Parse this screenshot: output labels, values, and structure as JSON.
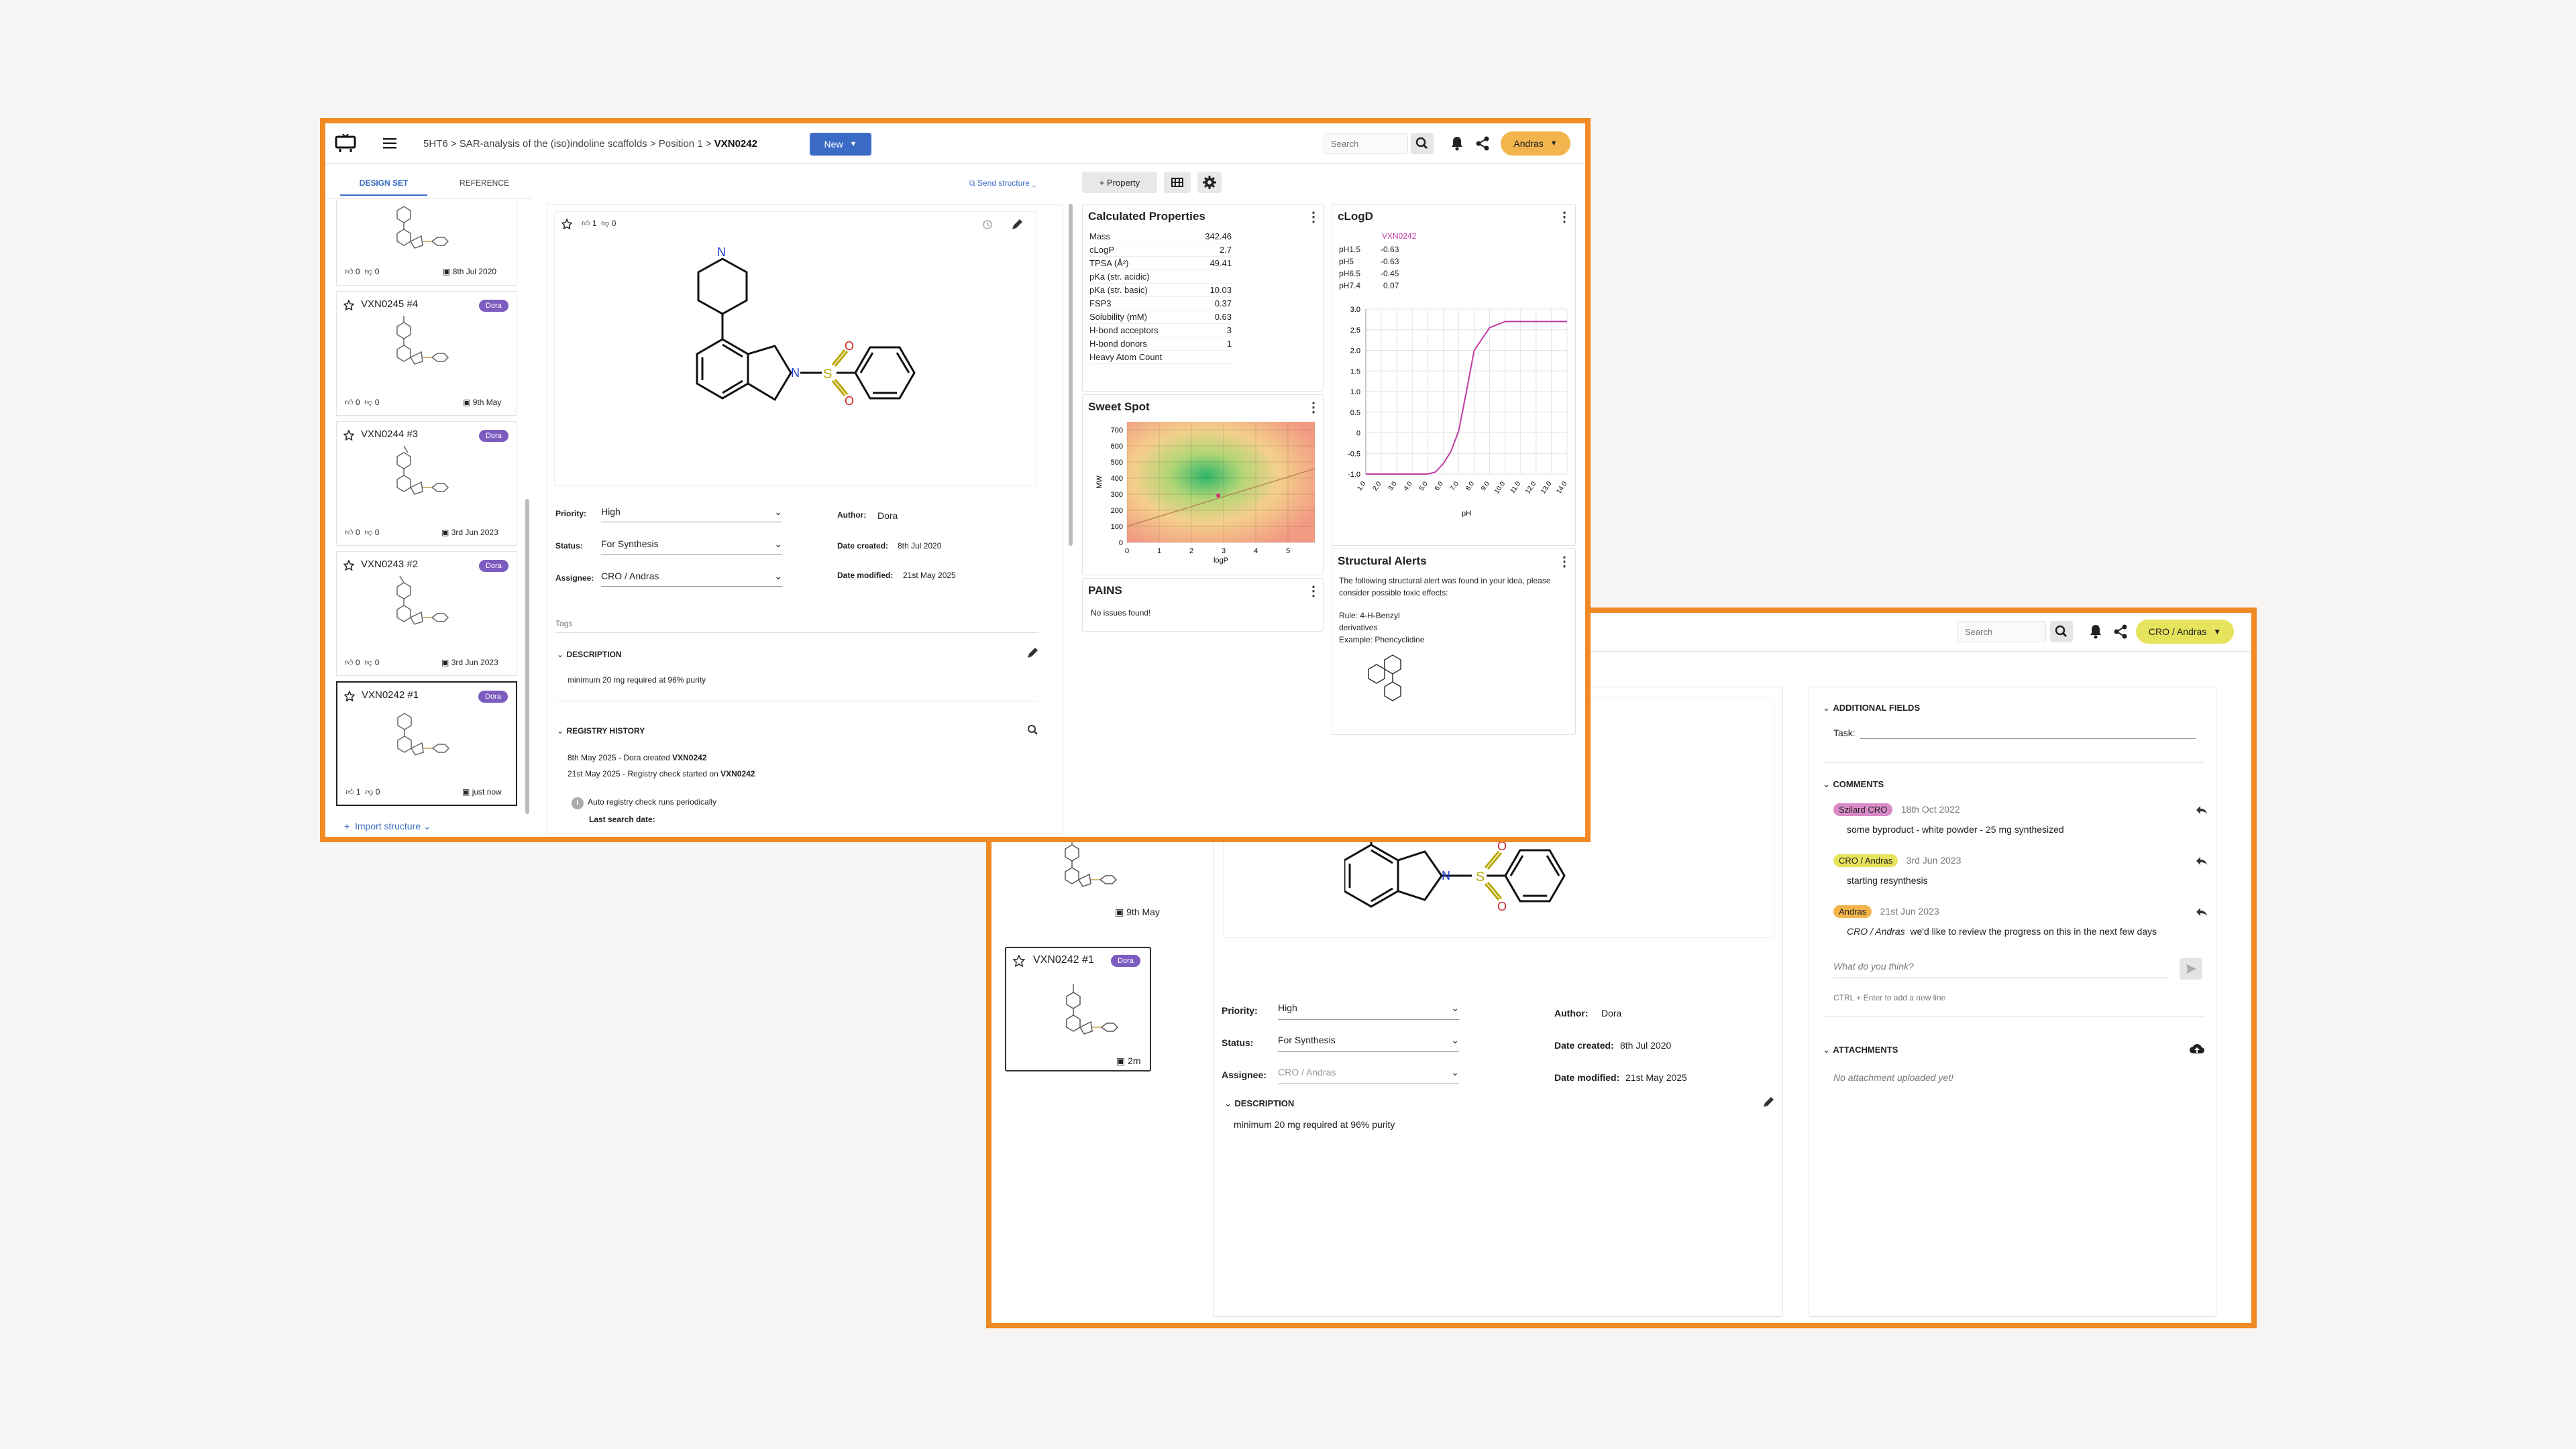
{
  "colors": {
    "accent": "#f08a24",
    "brand_blue": "#3b6cc5",
    "user_orange": "#f2b44d",
    "user_yellow": "#e6e35c",
    "badge_purple": "#7c5cbf",
    "clogd_line": "#c03ba0"
  },
  "w1": {
    "breadcrumb": [
      "5HT6",
      "SAR-analysis of the (iso)indoline scaffolds",
      "Position 1",
      "VXN0242"
    ],
    "new_label": "New",
    "search_placeholder": "Search",
    "user": "Andras",
    "tabs": [
      "DESIGN SET",
      "REFERENCE"
    ],
    "send_structure": "Send structure",
    "property_btn": "+ Property",
    "list": [
      {
        "name": "",
        "likes": "0",
        "dislikes": "0",
        "date": "8th Jul 2020"
      },
      {
        "name": "VXN0245 #4",
        "badge": "Dora",
        "likes": "0",
        "dislikes": "0",
        "date": "9th May"
      },
      {
        "name": "VXN0244 #3",
        "badge": "Dora",
        "likes": "0",
        "dislikes": "0",
        "date": "3rd Jun 2023"
      },
      {
        "name": "VXN0243 #2",
        "badge": "Dora",
        "likes": "0",
        "dislikes": "0",
        "date": "3rd Jun 2023"
      },
      {
        "name": "VXN0242 #1",
        "badge": "Dora",
        "likes": "1",
        "dislikes": "0",
        "date": "just now"
      }
    ],
    "import_structure": "Import structure",
    "detail": {
      "likes": "1",
      "dislikes": "0",
      "priority_label": "Priority:",
      "priority": "High",
      "status_label": "Status:",
      "status": "For Synthesis",
      "assignee_label": "Assignee:",
      "assignee": "CRO / Andras",
      "author_label": "Author:",
      "author": "Dora",
      "created_label": "Date created:",
      "created": "8th Jul 2020",
      "modified_label": "Date modified:",
      "modified": "21st May 2025",
      "tags": "Tags",
      "description_h": "DESCRIPTION",
      "description": "minimum 20 mg required at 96% purity",
      "registry_h": "REGISTRY HISTORY",
      "reg1_pre": "8th May 2025 - Dora created ",
      "reg1_id": "VXN0242",
      "reg2_pre": "21st May 2025 - Registry check started on ",
      "reg2_id": "VXN0242",
      "auto": "Auto registry check runs periodically",
      "last_search": "Last search date:"
    },
    "calc": {
      "title": "Calculated Properties",
      "rows": [
        [
          "Mass",
          "342.46"
        ],
        [
          "cLogP",
          "2.7"
        ],
        [
          "TPSA (Å²)",
          "49.41"
        ],
        [
          "pKa (str. acidic)",
          ""
        ],
        [
          "pKa (str. basic)",
          "10.03"
        ],
        [
          "FSP3",
          "0.37"
        ],
        [
          "Solubility (mM)",
          "0.63"
        ],
        [
          "H-bond acceptors",
          "3"
        ],
        [
          "H-bond donors",
          "1"
        ],
        [
          "Heavy Atom Count",
          ""
        ]
      ]
    },
    "sweet": {
      "title": "Sweet Spot",
      "yticks": [
        "700",
        "600",
        "500",
        "400",
        "300",
        "200",
        "100",
        "0"
      ],
      "xticks": [
        "0",
        "1",
        "2",
        "3",
        "4",
        "5"
      ],
      "xlabel": "logP",
      "ylabel": "MW"
    },
    "pains": {
      "title": "PAINS",
      "text": "No issues found!"
    },
    "alerts": {
      "title": "Structural Alerts",
      "text": "The following structural alert was found in your idea, please consider possible toxic effects:",
      "rule": "Rule: 4-H-Benzyl derivatives",
      "example": "Example: Phencyclidine"
    }
  },
  "chart_data": {
    "type": "line",
    "title": "cLogD",
    "series": [
      {
        "name": "VXN0242",
        "x": [
          1.0,
          3.0,
          4.0,
          5.0,
          5.5,
          6.0,
          6.5,
          7.0,
          7.5,
          8.0,
          9.0,
          10.0,
          14.0
        ],
        "y": [
          -1.0,
          -1.0,
          -1.0,
          -1.0,
          -0.95,
          -0.75,
          -0.45,
          0.05,
          1.0,
          2.0,
          2.55,
          2.7,
          2.7
        ]
      }
    ],
    "table": [
      [
        "pH1.5",
        "-0.63"
      ],
      [
        "pH5",
        "-0.63"
      ],
      [
        "pH6.5",
        "-0.45"
      ],
      [
        "pH7.4",
        "0.07"
      ]
    ],
    "xlabel": "pH",
    "ylabel": "",
    "xlim": [
      1,
      14
    ],
    "ylim": [
      -1.0,
      3.0
    ],
    "xticks": [
      "1.0",
      "2.0",
      "3.0",
      "4.0",
      "5.0",
      "6.0",
      "7.0",
      "8.0",
      "9.0",
      "10.0",
      "11.0",
      "12.0",
      "13.0",
      "14.0"
    ],
    "yticks": [
      "3.0",
      "2.5",
      "2.0",
      "1.5",
      "1.0",
      "0.5",
      "0",
      "-0.5",
      "-1.0"
    ],
    "grid": true
  },
  "w2": {
    "search_placeholder": "Search",
    "user": "CRO / Andras",
    "list": [
      {
        "date": "9th May"
      },
      {
        "name": "VXN0242 #1",
        "badge": "Dora",
        "date": "2m"
      }
    ],
    "detail": {
      "priority_label": "Priority:",
      "priority": "High",
      "status_label": "Status:",
      "status": "For Synthesis",
      "assignee_label": "Assignee:",
      "assignee": "CRO / Andras",
      "author_label": "Author:",
      "author": "Dora",
      "created_label": "Date created:",
      "created": "8th Jul 2020",
      "modified_label": "Date modified:",
      "modified": "21st May 2025",
      "description_h": "DESCRIPTION",
      "description": "minimum 20 mg required at 96% purity"
    },
    "additional_h": "ADDITIONAL FIELDS",
    "task_label": "Task:",
    "comments_h": "COMMENTS",
    "comments": [
      {
        "user": "Szilard CRO",
        "date": "18th Oct 2022",
        "text": "some byproduct - white powder - 25 mg synthesized"
      },
      {
        "user": "CRO / Andras",
        "date": "3rd Jun 2023",
        "text": "starting resynthesis"
      },
      {
        "user": "Andras",
        "date": "21st Jun 2023",
        "mention": "CRO / Andras",
        "text": "we'd like to review the progress on this in the next few days"
      }
    ],
    "comment_placeholder": "What do you think?",
    "comment_hint": "CTRL + Enter to add a new line",
    "attachments_h": "ATTACHMENTS",
    "attachments_empty": "No attachment uploaded yet!"
  }
}
